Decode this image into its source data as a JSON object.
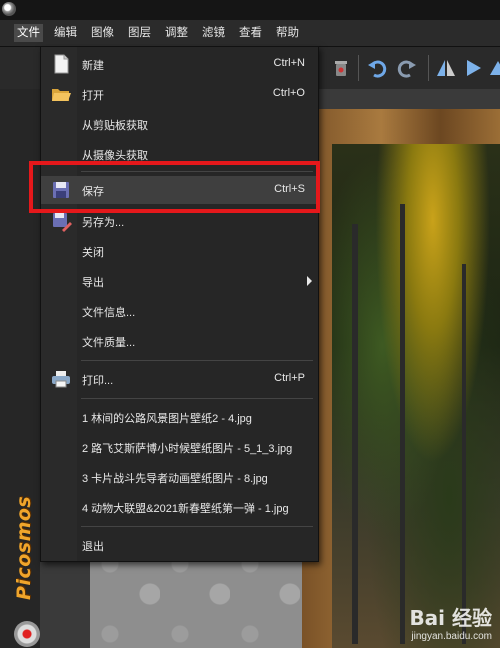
{
  "menubar": {
    "items": [
      "文件",
      "编辑",
      "图像",
      "图层",
      "调整",
      "滤镜",
      "查看",
      "帮助"
    ],
    "active_index": 0
  },
  "file_menu": {
    "items": [
      {
        "label": "新建",
        "shortcut": "Ctrl+N",
        "icon": "new-file-icon"
      },
      {
        "label": "打开",
        "shortcut": "Ctrl+O",
        "icon": "open-folder-icon"
      },
      {
        "label": "从剪贴板获取",
        "shortcut": "",
        "icon": ""
      },
      {
        "label": "从摄像头获取",
        "shortcut": "",
        "icon": ""
      },
      {
        "label": "保存",
        "shortcut": "Ctrl+S",
        "icon": "save-disk-icon"
      },
      {
        "label": "另存为...",
        "shortcut": "",
        "icon": "save-as-icon"
      },
      {
        "label": "关闭",
        "shortcut": "",
        "icon": ""
      },
      {
        "label": "导出",
        "shortcut": "",
        "icon": ""
      },
      {
        "label": "文件信息...",
        "shortcut": "",
        "icon": ""
      },
      {
        "label": "文件质量...",
        "shortcut": "",
        "icon": ""
      },
      {
        "label": "打印...",
        "shortcut": "Ctrl+P",
        "icon": "printer-icon"
      },
      {
        "label": "1 林间的公路风景图片壁纸2 - 4.jpg",
        "shortcut": "",
        "icon": ""
      },
      {
        "label": "2 路飞艾斯萨博小时候壁纸图片 - 5_1_3.jpg",
        "shortcut": "",
        "icon": ""
      },
      {
        "label": "3 卡片战斗先导者动画壁纸图片 - 8.jpg",
        "shortcut": "",
        "icon": ""
      },
      {
        "label": "4 动物大联盟&2021新春壁纸第一弹 - 1.jpg",
        "shortcut": "",
        "icon": ""
      },
      {
        "label": "退出",
        "shortcut": "",
        "icon": ""
      }
    ],
    "highlighted_item": "保存"
  },
  "branding": {
    "text": "Picosmos"
  },
  "watermark": {
    "logo": "Bai 经验",
    "url": "jingyan.baidu.com"
  },
  "colors": {
    "highlight_box": "#e5181b",
    "brand": "#f0a52b",
    "menu_bg": "#262626"
  }
}
